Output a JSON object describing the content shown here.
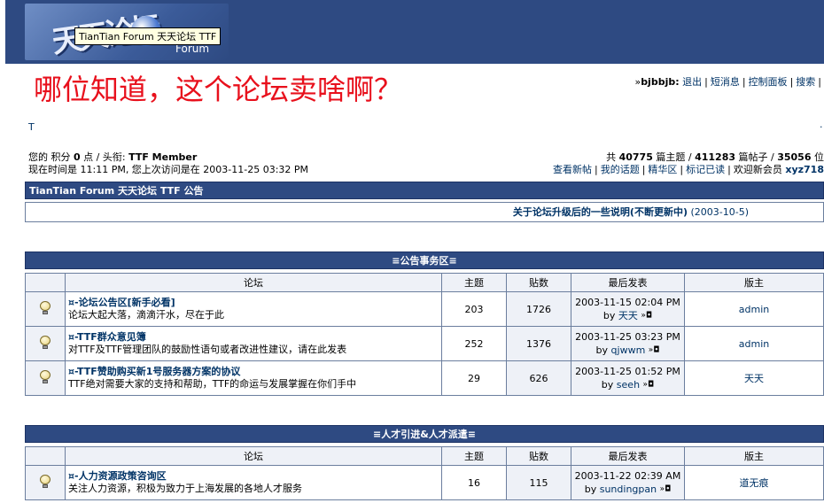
{
  "header": {
    "logo_text": "天天论坛",
    "logo_subtext": "Forum",
    "tooltip": "TianTian Forum 天天论坛 TTF"
  },
  "headline": "哪位知道，这个论坛卖啥啊？",
  "usernav": {
    "prefix": "»",
    "username": "bjbbjb:",
    "links": [
      "退出",
      "短消息",
      "控制面板",
      "搜索"
    ]
  },
  "stray_mark_left": "T",
  "stray_mark_right": "·",
  "stats_left": {
    "line1_a": "您的 积分 ",
    "points": "0",
    "line1_b": " 点 / 头衔: ",
    "title": "TTF Member",
    "line2": "现在时间是 11:11 PM, 您上次访问是在 2003-11-25 03:32 PM"
  },
  "stats_right": {
    "a": "共 ",
    "topics": "40775",
    "b": " 篇主题 / ",
    "posts": "411283",
    "c": " 篇帖子 / ",
    "members": "35056",
    "d": " 位",
    "links": [
      "查看新帖",
      "我的话题",
      "精华区",
      "标记已读"
    ],
    "welcome": "欢迎新会员 ",
    "newest": "xyz718"
  },
  "announcement": {
    "bar": "TianTian Forum 天天论坛 TTF 公告",
    "title": "关于论坛升级后的一些说明(不断更新中)",
    "date": "(2003-10-5)"
  },
  "columns": {
    "forum": "论坛",
    "topics": "主题",
    "posts": "贴数",
    "last": "最后发表",
    "mod": "版主"
  },
  "section1": {
    "title": "≡公告事务区≡",
    "rows": [
      {
        "name": "¤-论坛公告区[新手必看]",
        "desc": "论坛大起大落，滴滴汗水，尽在于此",
        "topics": "203",
        "posts": "1726",
        "last_time": "2003-11-15 02:04 PM",
        "last_by_prefix": "by ",
        "last_by": "天天",
        "mod": "admin"
      },
      {
        "name": "¤-TTF群众意见簿",
        "desc": "对TTF及TTF管理团队的鼓励性语句或者改进性建议，请在此发表",
        "topics": "252",
        "posts": "1376",
        "last_time": "2003-11-25 03:23 PM",
        "last_by_prefix": "by ",
        "last_by": "qjwwm",
        "mod": "admin"
      },
      {
        "name": "¤-TTF赞助购买新1号服务器方案的协议",
        "desc": "TTF绝对需要大家的支持和帮助，TTF的命运与发展掌握在你们手中",
        "topics": "29",
        "posts": "626",
        "last_time": "2003-11-25 01:52 PM",
        "last_by_prefix": "by ",
        "last_by": "seeh",
        "mod": "天天"
      }
    ]
  },
  "section2": {
    "title": "≡人才引进&人才派遣≡",
    "rows": [
      {
        "name": "¤-人力资源政策咨询区",
        "desc": "关注人力资源，积极为致力于上海发展的各地人才服务",
        "topics": "16",
        "posts": "115",
        "last_time": "2003-11-22 02:39 AM",
        "last_by_prefix": "by ",
        "last_by": "sundingpan",
        "mod": "道无痕"
      }
    ]
  },
  "go_icon": "»◘"
}
